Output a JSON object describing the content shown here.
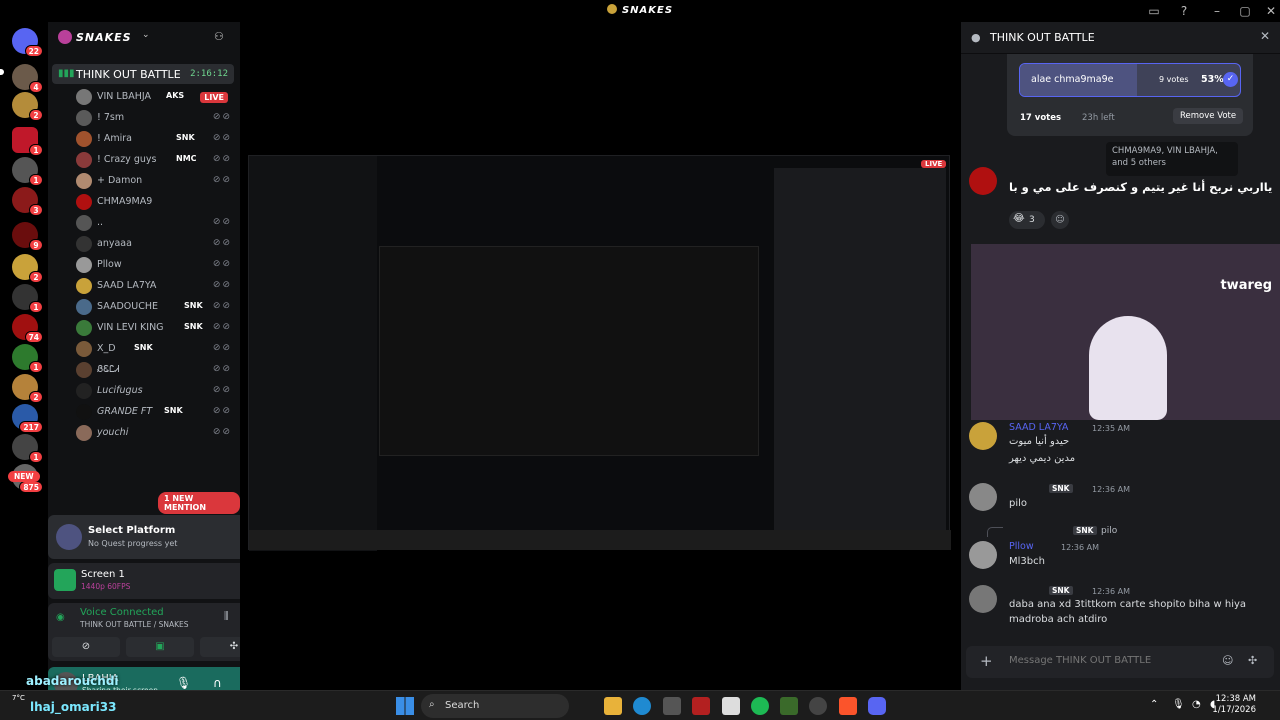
{
  "app": {
    "title": "SNAKES"
  },
  "rail": {
    "badges": [
      "22",
      "4",
      "2",
      "1",
      "1",
      "3",
      "9",
      "2",
      "1",
      "74",
      "1",
      "2",
      "217",
      "1",
      "875",
      "NEW"
    ]
  },
  "sidebar": {
    "guild_name": "SNAKES",
    "voice_channel": {
      "name": "THINK OUT BATTLE",
      "timer": "2:16:12"
    },
    "members": [
      {
        "name": "VIN LBAHJA",
        "tag": "AKS",
        "live": "LIVE"
      },
      {
        "name": "! 7sm"
      },
      {
        "name": "! Amira",
        "tag": "SNK"
      },
      {
        "name": "! Crazy guys",
        "tag": "NMC"
      },
      {
        "name": "+ Damon"
      },
      {
        "name": "CHMA9MA9"
      },
      {
        "name": ".."
      },
      {
        "name": "anyaaa"
      },
      {
        "name": "Pllow"
      },
      {
        "name": "SAAD LA7YA"
      },
      {
        "name": "SAADOUCHE",
        "tag": "SNK"
      },
      {
        "name": "VIN LEVI KING",
        "tag": "SNK"
      },
      {
        "name": "X_D",
        "tag": "SNK"
      },
      {
        "name": "ᏰᏋᏝᏗ"
      },
      {
        "name": "Lucifugus"
      },
      {
        "name": "GRANDE FT",
        "tag": "SNK"
      },
      {
        "name": "youchi"
      }
    ],
    "new_mention": "1 NEW MENTION",
    "activity": {
      "title": "Select Platform",
      "subtitle": "No Quest progress yet"
    },
    "screen": {
      "title": "Screen 1",
      "quality": "1440p 60FPS"
    },
    "voice": {
      "status": "Voice Connected",
      "channel": "THINK OUT BATTLE / SNAKES"
    },
    "user": {
      "name": "LBAHJA",
      "status": "Sharing their screen"
    }
  },
  "chat": {
    "title": "THINK OUT BATTLE",
    "poll": {
      "option": "alae chma9ma9e",
      "votes": "9 votes",
      "percent": "53%",
      "percent_value": 53,
      "total": "17 votes",
      "time_left": "23h left",
      "remove_label": "Remove Vote"
    },
    "voters_tooltip": "CHMA9MA9, VIN LBAHJA, and 5 others",
    "top_message": {
      "text": "يااربي نربح أنا غير يتيم و كنصرف على مي و با",
      "reaction_count": "3"
    },
    "messages": [
      {
        "author": "SAAD LA7YA",
        "time": "12:35 AM",
        "lines": [
          "حيدو أنيا ميوت",
          "مدين ديمي ديهر"
        ]
      },
      {
        "author": "",
        "tag": "SNK",
        "time": "12:36 AM",
        "lines": [
          "pilo"
        ]
      },
      {
        "author": "Pllow",
        "reply": "pilo",
        "time": "12:36 AM",
        "lines": [
          "Ml3bch"
        ]
      },
      {
        "author": "",
        "tag": "SNK",
        "time": "12:36 AM",
        "lines": [
          "daba ana xd 3tittkom carte shopito biha w hiya",
          "madroba ach atdiro"
        ]
      }
    ],
    "input_placeholder": "Message THINK OUT BATTLE",
    "cam_brand": "twareg"
  },
  "taskbar": {
    "search": "Search",
    "user_text": "lhaj_omari33",
    "overlay_text": "abadarouchdi",
    "weather": "7°C",
    "time": "12:38 AM",
    "date": "1/17/2026"
  },
  "colors": {
    "accent": "#5865f2",
    "live": "#da373c",
    "online": "#23a55a",
    "user_panel": "#1a6b5e"
  }
}
